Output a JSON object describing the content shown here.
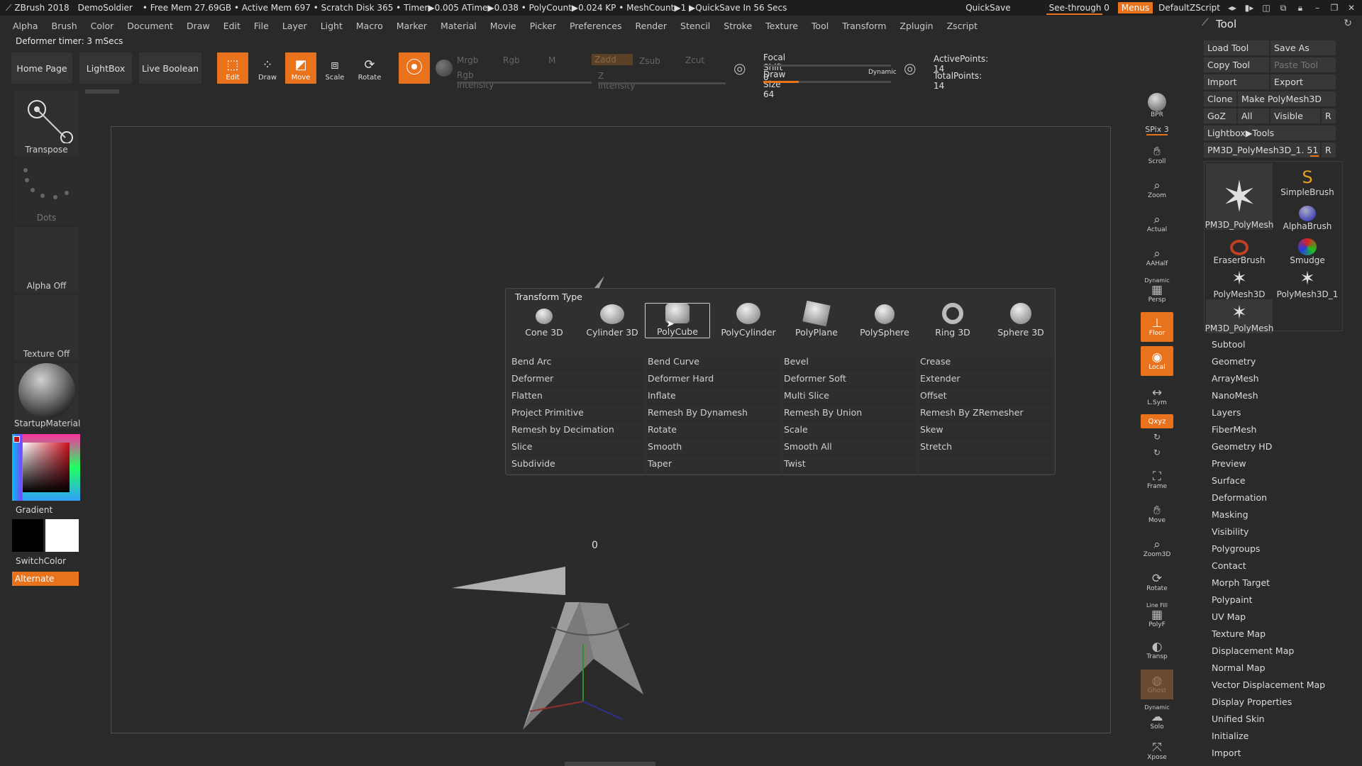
{
  "titlebar": {
    "app": "ZBrush 2018",
    "project": "DemoSoldier",
    "stats": "• Free Mem 27.69GB • Active Mem 697 • Scratch Disk 365 • Timer▶0.005 ATime▶0.038 • PolyCount▶0.024 KP • MeshCount▶1 ▶QuickSave In 56 Secs",
    "quicksave": "QuickSave",
    "see_through": "See-through 0",
    "menus": "Menus",
    "default_zscript": "DefaultZScript"
  },
  "menubar": [
    "Alpha",
    "Brush",
    "Color",
    "Document",
    "Draw",
    "Edit",
    "File",
    "Layer",
    "Light",
    "Macro",
    "Marker",
    "Material",
    "Movie",
    "Picker",
    "Preferences",
    "Render",
    "Stencil",
    "Stroke",
    "Texture",
    "Tool",
    "Transform",
    "Zplugin",
    "Zscript"
  ],
  "status": {
    "deformer_timer": "Deformer timer: 3 mSecs"
  },
  "toolbar": {
    "home_page": "Home Page",
    "lightbox": "LightBox",
    "live_boolean": "Live Boolean",
    "edit": "Edit",
    "draw": "Draw",
    "move": "Move",
    "scale": "Scale",
    "rotate": "Rotate",
    "mrgb": "Mrgb",
    "rgb": "Rgb",
    "m": "M",
    "zadd": "Zadd",
    "zsub": "Zsub",
    "zcut": "Zcut",
    "rgb_intensity": "Rgb Intensity",
    "z_intensity": "Z Intensity",
    "focal_shift": "Focal Shift 0",
    "draw_size": "Draw Size 64",
    "dynamic": "Dynamic",
    "active_points": "ActivePoints: 14",
    "total_points": "TotalPoints: 14"
  },
  "left_shelf": {
    "transpose": "Transpose",
    "dots": "Dots",
    "alpha_off": "Alpha Off",
    "texture_off": "Texture Off",
    "material": "StartupMaterial",
    "gradient": "Gradient",
    "switch_color": "SwitchColor",
    "alternate": "Alternate"
  },
  "popup": {
    "title": "Transform Type",
    "shapes": [
      "Cone 3D",
      "Cylinder 3D",
      "PolyCube",
      "PolyCylinder",
      "PolyPlane",
      "PolySphere",
      "Ring 3D",
      "Sphere 3D"
    ],
    "selected_shape": "PolyCube",
    "actions": [
      "Bend Arc",
      "Bend Curve",
      "Bevel",
      "Crease",
      "Deformer",
      "Deformer Hard",
      "Deformer Soft",
      "Extender",
      "Flatten",
      "Inflate",
      "Multi Slice",
      "Offset",
      "Project Primitive",
      "Remesh By Dynamesh",
      "Remesh By Union",
      "Remesh By ZRemesher",
      "Remesh by Decimation",
      "Rotate",
      "Scale",
      "Skew",
      "Slice",
      "Smooth",
      "Smooth All",
      "Stretch",
      "Subdivide",
      "Taper",
      "Twist",
      ""
    ]
  },
  "viewport": {
    "gizmo_value": "0"
  },
  "right_column": {
    "bpr": "BPR",
    "spix": "SPix 3",
    "scroll": "Scroll",
    "zoom": "Zoom",
    "actual": "Actual",
    "aahalf": "AAHalf",
    "dynamic": "Dynamic",
    "persp": "Persp",
    "floor": "Floor",
    "local": "Local",
    "lsym": "L.Sym",
    "xyz": "Qxyz",
    "frame": "Frame",
    "move": "Move",
    "zoom3d": "Zoom3D",
    "rotate": "Rotate",
    "line_fill": "Line Fill",
    "polyf": "PolyF",
    "transp": "Transp",
    "ghost": "Ghost",
    "dynamic2": "Dynamic",
    "solo": "Solo",
    "xpose": "Xpose"
  },
  "tool_panel": {
    "title": "Tool",
    "load_tool": "Load Tool",
    "save_as": "Save As",
    "copy_tool": "Copy Tool",
    "paste_tool": "Paste Tool",
    "import": "Import",
    "export": "Export",
    "clone": "Clone",
    "make_polymesh": "Make PolyMesh3D",
    "goz": "GoZ",
    "all": "All",
    "visible": "Visible",
    "r": "R",
    "lightbox_tools": "Lightbox▶Tools",
    "current_tool": "PM3D_PolyMesh3D_1. 51",
    "thumbs": [
      "PM3D_PolyMesh",
      "SimpleBrush",
      "AlphaBrush",
      "EraserBrush",
      "Smudge",
      "PolyMesh3D",
      "PolyMesh3D_1",
      "PM3D_PolyMesh"
    ],
    "sections": [
      "Subtool",
      "Geometry",
      "ArrayMesh",
      "NanoMesh",
      "Layers",
      "FiberMesh",
      "Geometry HD",
      "Preview",
      "Surface",
      "Deformation",
      "Masking",
      "Visibility",
      "Polygroups",
      "Contact",
      "Morph Target",
      "Polypaint",
      "UV Map",
      "Texture Map",
      "Displacement Map",
      "Normal Map",
      "Vector Displacement Map",
      "Display Properties",
      "Unified Skin",
      "Initialize",
      "Import"
    ]
  }
}
